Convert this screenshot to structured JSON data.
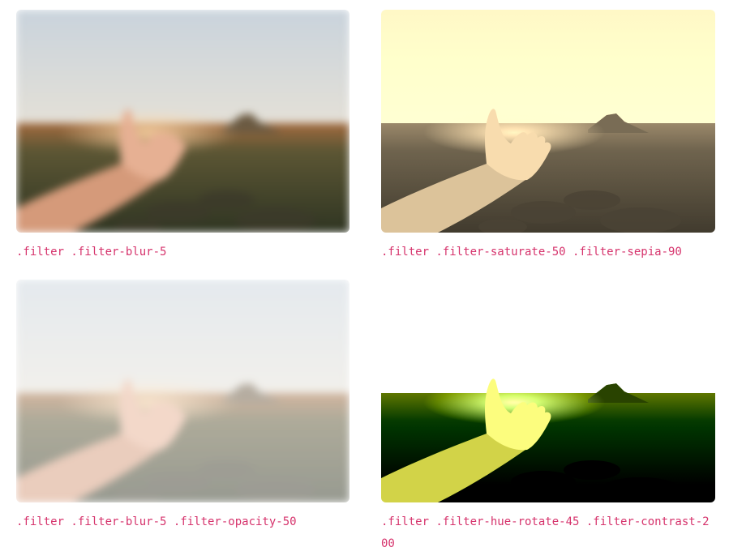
{
  "cards": [
    {
      "caption": ".filter .filter-blur-5",
      "image": "hand-landscape-photo"
    },
    {
      "caption": ".filter .filter-saturate-50 .filter-sepia-90",
      "image": "hand-landscape-photo"
    },
    {
      "caption": ".filter .filter-blur-5 .filter-opacity-50",
      "image": "hand-landscape-photo"
    },
    {
      "caption": ".filter .filter-hue-rotate-45 .filter-contrast-200",
      "image": "hand-landscape-photo"
    }
  ],
  "colors": {
    "caption_text": "#d6336c",
    "background": "#ffffff"
  }
}
